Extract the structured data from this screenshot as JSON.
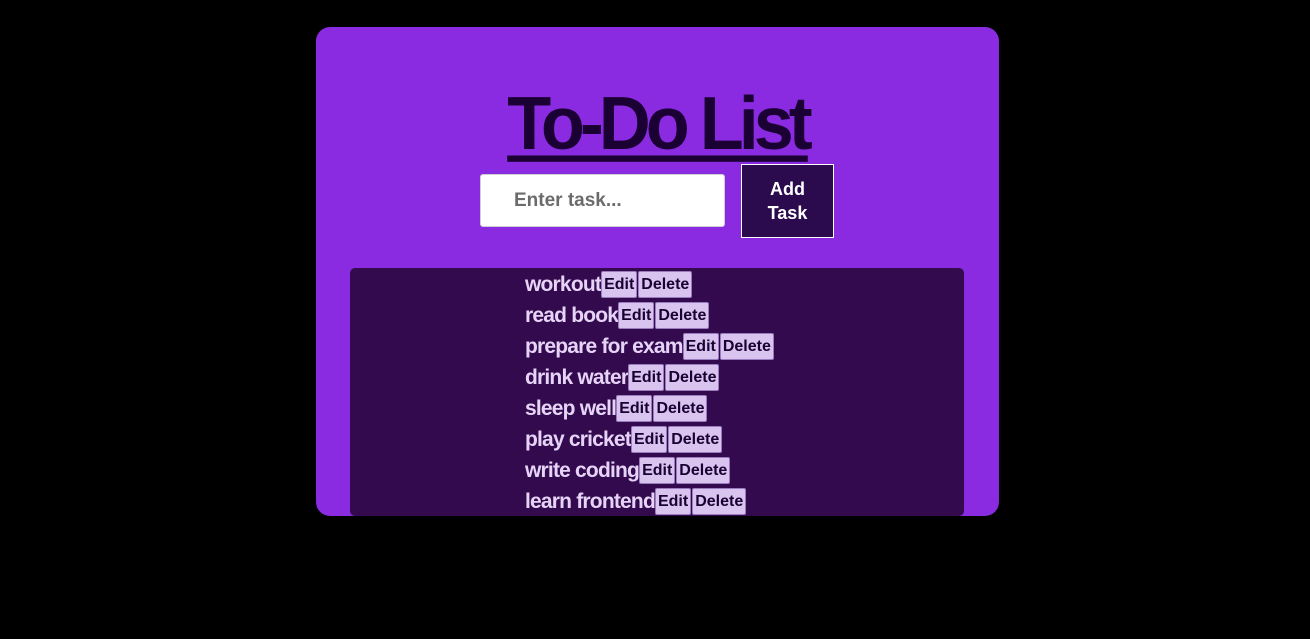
{
  "header": {
    "title": "To-Do List"
  },
  "form": {
    "placeholder": "Enter task...",
    "value": "",
    "add_label": "Add Task"
  },
  "tasks": [
    {
      "text": "workout",
      "edit_label": "Edit",
      "delete_label": "Delete"
    },
    {
      "text": "read book",
      "edit_label": "Edit",
      "delete_label": "Delete"
    },
    {
      "text": "prepare for exam",
      "edit_label": "Edit",
      "delete_label": "Delete"
    },
    {
      "text": "drink water",
      "edit_label": "Edit",
      "delete_label": "Delete"
    },
    {
      "text": "sleep well",
      "edit_label": "Edit",
      "delete_label": "Delete"
    },
    {
      "text": "play cricket",
      "edit_label": "Edit",
      "delete_label": "Delete"
    },
    {
      "text": "write coding",
      "edit_label": "Edit",
      "delete_label": "Delete"
    },
    {
      "text": "learn frontend",
      "edit_label": "Edit",
      "delete_label": "Delete"
    }
  ],
  "colors": {
    "page_background": "#000000",
    "card_background": "#8a2be2",
    "list_background": "#340a4f",
    "button_dark": "#2b0a4d",
    "task_text": "#e6d4f7",
    "button_light": "#d8c4ee"
  }
}
